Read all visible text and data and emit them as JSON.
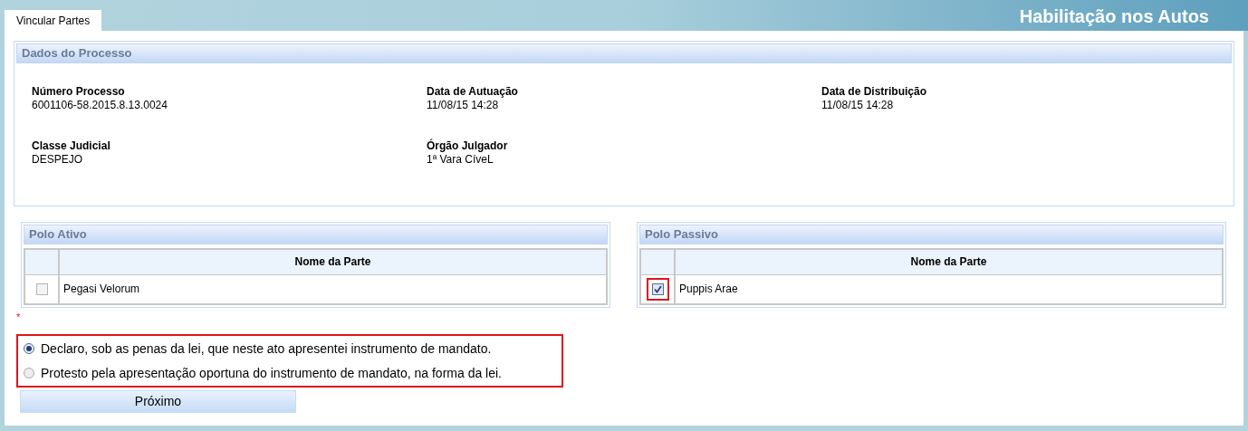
{
  "tabs": [
    {
      "label": "Vincular Partes",
      "selected": true
    }
  ],
  "page_title": "Habilitação nos Autos",
  "process_section": {
    "title": "Dados do Processo",
    "fields": [
      {
        "label": "Número Processo",
        "value": "6001106-58.2015.8.13.0024"
      },
      {
        "label": "Data de Autuação",
        "value": "11/08/15 14:28"
      },
      {
        "label": "Data de Distribuição",
        "value": "11/08/15 14:28"
      },
      {
        "label": "Classe Judicial",
        "value": "DESPEJO"
      },
      {
        "label": "Órgão Julgador",
        "value": "1ª Vara CíveL"
      }
    ]
  },
  "parties": [
    {
      "title": "Polo Ativo",
      "column": "Nome da Parte",
      "rows": [
        {
          "name": "Pegasi Velorum",
          "checked": false,
          "highlighted": false
        }
      ]
    },
    {
      "title": "Polo Passivo",
      "column": "Nome da Parte",
      "rows": [
        {
          "name": "Puppis Arae",
          "checked": true,
          "highlighted": true
        }
      ]
    }
  ],
  "required_mark": "*",
  "declaration": {
    "highlighted": true,
    "options": [
      {
        "label": "Declaro, sob as penas da lei, que neste ato apresentei instrumento de mandato.",
        "selected": true
      },
      {
        "label": "Protesto pela apresentação oportuna do instrumento de mandato, na forma da lei.",
        "selected": false
      }
    ]
  },
  "next_button": "Próximo"
}
